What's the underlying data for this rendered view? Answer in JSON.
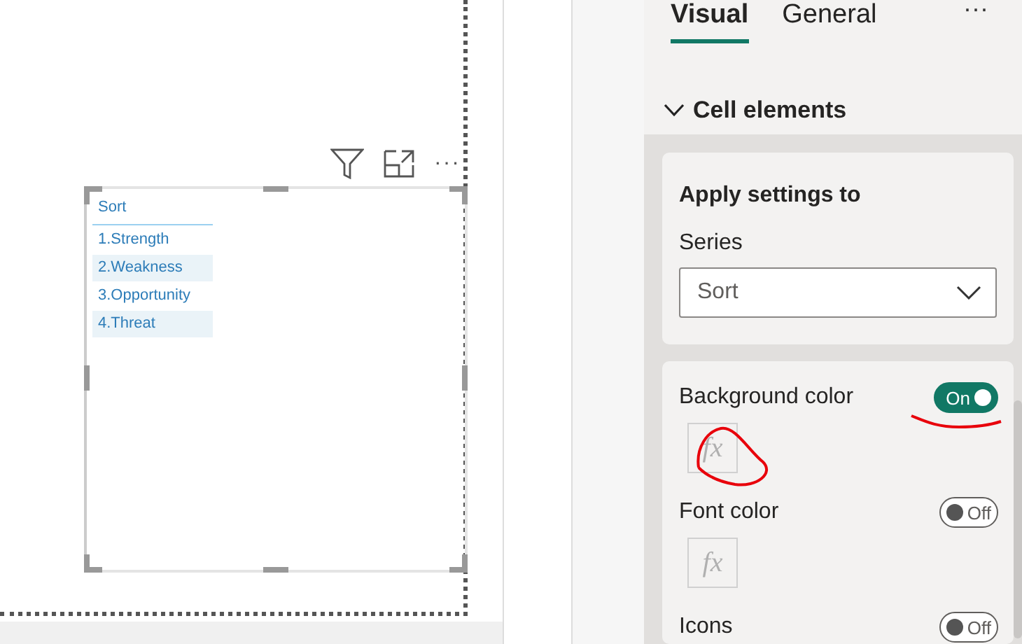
{
  "visual_header": {
    "more": "···"
  },
  "table": {
    "column": "Sort",
    "rows": [
      "1.Strength",
      "2.Weakness",
      "3.Opportunity",
      "4.Threat"
    ]
  },
  "pane": {
    "tabs": [
      {
        "label": "Visual",
        "selected": true
      },
      {
        "label": "General",
        "selected": false
      }
    ],
    "more": "···",
    "section": {
      "title": "Cell elements",
      "expanded": true
    },
    "apply_card": {
      "title": "Apply settings to",
      "series_label": "Series",
      "series_value": "Sort"
    },
    "settings": [
      {
        "label": "Background color",
        "on": true,
        "toggle_text": "On",
        "fx": "fx"
      },
      {
        "label": "Font color",
        "on": false,
        "toggle_text": "Off",
        "fx": "fx"
      },
      {
        "label": "Icons",
        "on": false,
        "toggle_text": "Off"
      }
    ]
  }
}
